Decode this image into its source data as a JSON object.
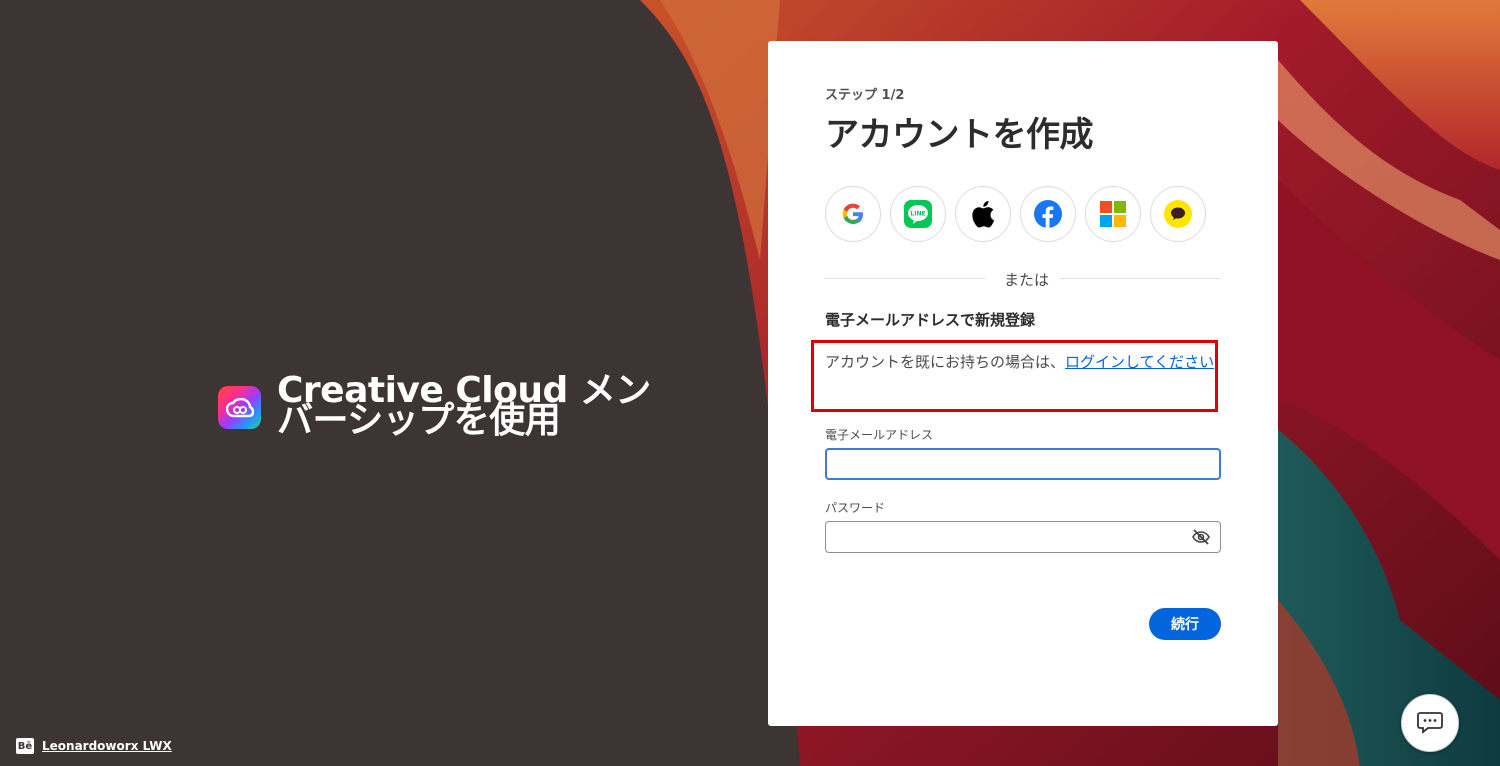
{
  "brand": {
    "title": "Creative Cloud メンバーシップを使用"
  },
  "footer": {
    "behance_icon": "Bē",
    "behance_credit": "Leonardoworx LWX"
  },
  "form": {
    "step": "ステップ 1/2",
    "title": "アカウントを作成",
    "socials": [
      {
        "name": "google-icon"
      },
      {
        "name": "line-icon"
      },
      {
        "name": "apple-icon"
      },
      {
        "name": "facebook-icon"
      },
      {
        "name": "microsoft-icon"
      },
      {
        "name": "kakaotalk-icon"
      }
    ],
    "divider_text": "または",
    "email_heading": "電子メールアドレスで新規登録",
    "existing_account_text": "アカウントを既にお持ちの場合は、",
    "login_link": "ログインしてください",
    "email_label": "電子メールアドレス",
    "email_value": "",
    "password_label": "パスワード",
    "password_value": "",
    "continue_label": "続行"
  },
  "colors": {
    "accent": "#0265dc",
    "highlight": "#e00000",
    "background": "#3d3533"
  }
}
